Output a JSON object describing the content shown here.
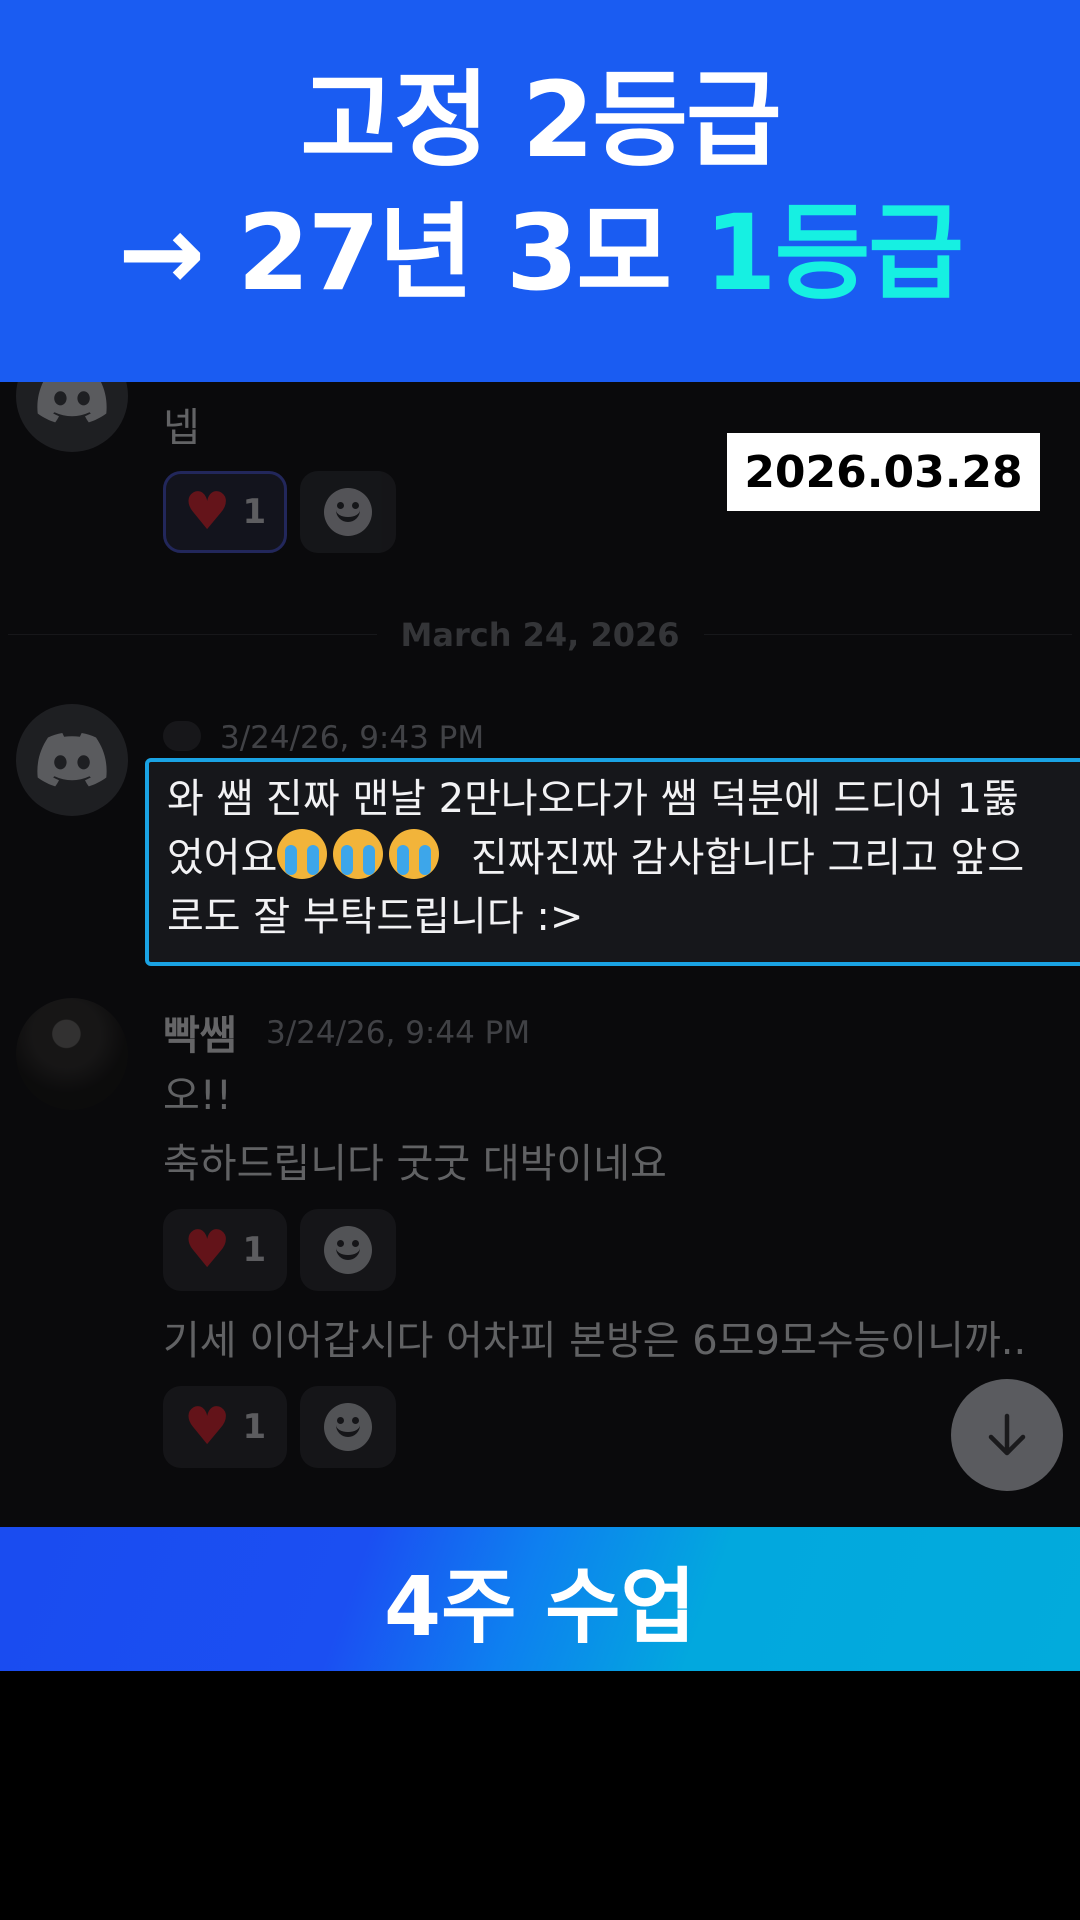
{
  "top_banner": {
    "line1": "고정 2등급",
    "line2_prefix": "→ 27년 3모 ",
    "line2_accent": "1등급"
  },
  "date_stamp": "2026.03.28",
  "previous_message": {
    "text": "넵",
    "reaction_count": "1"
  },
  "divider": {
    "label": "March 24, 2026"
  },
  "student_message": {
    "timestamp": "3/24/26, 9:43 PM",
    "line1": "와 쌤 진짜 맨날 2만나오다가 쌤 덕분에 드디어 1뚫",
    "line2_start": "었어요",
    "line2_end": "  진짜진짜 감사합니다 그리고 앞으",
    "line3": "로도 잘 부탁드립니다 :>"
  },
  "teacher_message": {
    "username": "빡쌤",
    "timestamp": "3/24/26, 9:44 PM",
    "line1": "오!!",
    "line2": "축하드립니다 굿굿 대박이네요",
    "reaction1_count": "1",
    "line3": "기세 이어갑시다 어차피 본방은 6모9모수능이니까..",
    "reaction2_count": "1"
  },
  "bottom_banner": {
    "label": "4주 수업"
  },
  "colors": {
    "banner_blue": "#1a5cf2",
    "accent_cyan": "#16f0e2",
    "highlight_border": "#1aa3e4",
    "heart_red": "#e0222e"
  },
  "icons": [
    "discord-logo-icon",
    "heart-icon",
    "add-reaction-smiley-icon",
    "crying-face-emoji-icon",
    "arrow-down-icon"
  ]
}
